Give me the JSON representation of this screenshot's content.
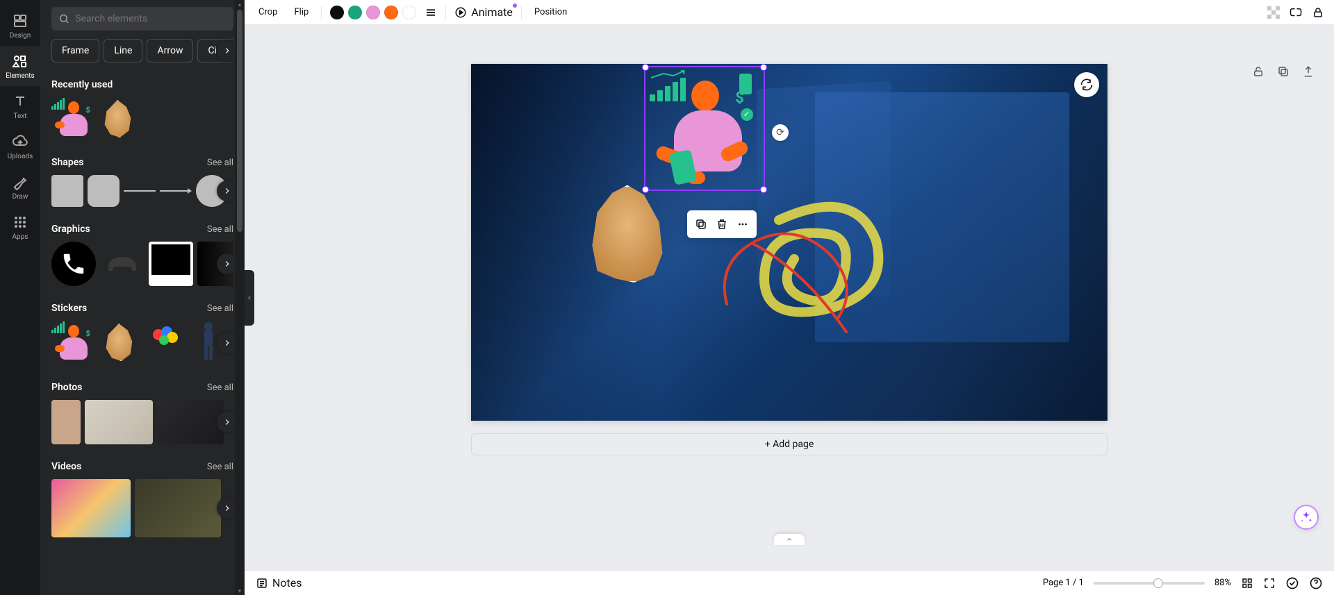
{
  "nav": {
    "items": [
      {
        "label": "Design"
      },
      {
        "label": "Elements"
      },
      {
        "label": "Text"
      },
      {
        "label": "Uploads"
      },
      {
        "label": "Draw"
      },
      {
        "label": "Apps"
      }
    ]
  },
  "search": {
    "placeholder": "Search elements"
  },
  "chips": [
    "Frame",
    "Line",
    "Arrow",
    "Circle"
  ],
  "sections": {
    "recently_used": {
      "title": "Recently used"
    },
    "shapes": {
      "title": "Shapes",
      "see_all": "See all"
    },
    "graphics": {
      "title": "Graphics",
      "see_all": "See all"
    },
    "stickers": {
      "title": "Stickers",
      "see_all": "See all"
    },
    "photos": {
      "title": "Photos",
      "see_all": "See all"
    },
    "videos": {
      "title": "Videos",
      "see_all": "See all"
    }
  },
  "toolbar": {
    "crop": "Crop",
    "flip": "Flip",
    "animate": "Animate",
    "position": "Position",
    "colors": [
      "#0d0d0d",
      "#18a67b",
      "#e896d8",
      "#ff6a13",
      "#ffffff"
    ]
  },
  "float": {},
  "add_page": "+ Add page",
  "bottom": {
    "notes": "Notes",
    "page_indicator": "Page 1 / 1",
    "zoom": "88%"
  }
}
